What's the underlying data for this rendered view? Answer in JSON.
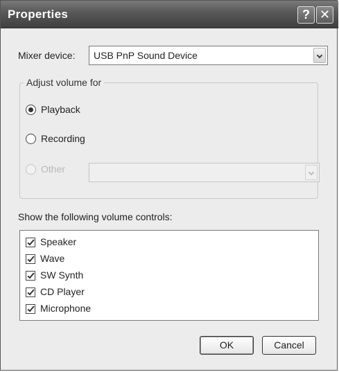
{
  "window": {
    "title": "Properties",
    "help_symbol": "?",
    "close_symbol": "✕"
  },
  "mixer": {
    "label": "Mixer device:",
    "value": "USB PnP Sound Device"
  },
  "adjust": {
    "legend": "Adjust volume for",
    "options": [
      {
        "label": "Playback",
        "checked": true,
        "enabled": true
      },
      {
        "label": "Recording",
        "checked": false,
        "enabled": true
      },
      {
        "label": "Other",
        "checked": false,
        "enabled": false
      }
    ],
    "other_combo_value": ""
  },
  "controls": {
    "label": "Show the following volume controls:",
    "items": [
      {
        "label": "Speaker",
        "checked": true
      },
      {
        "label": "Wave",
        "checked": true
      },
      {
        "label": "SW Synth",
        "checked": true
      },
      {
        "label": "CD Player",
        "checked": true
      },
      {
        "label": "Microphone",
        "checked": true
      }
    ]
  },
  "buttons": {
    "ok": "OK",
    "cancel": "Cancel"
  }
}
